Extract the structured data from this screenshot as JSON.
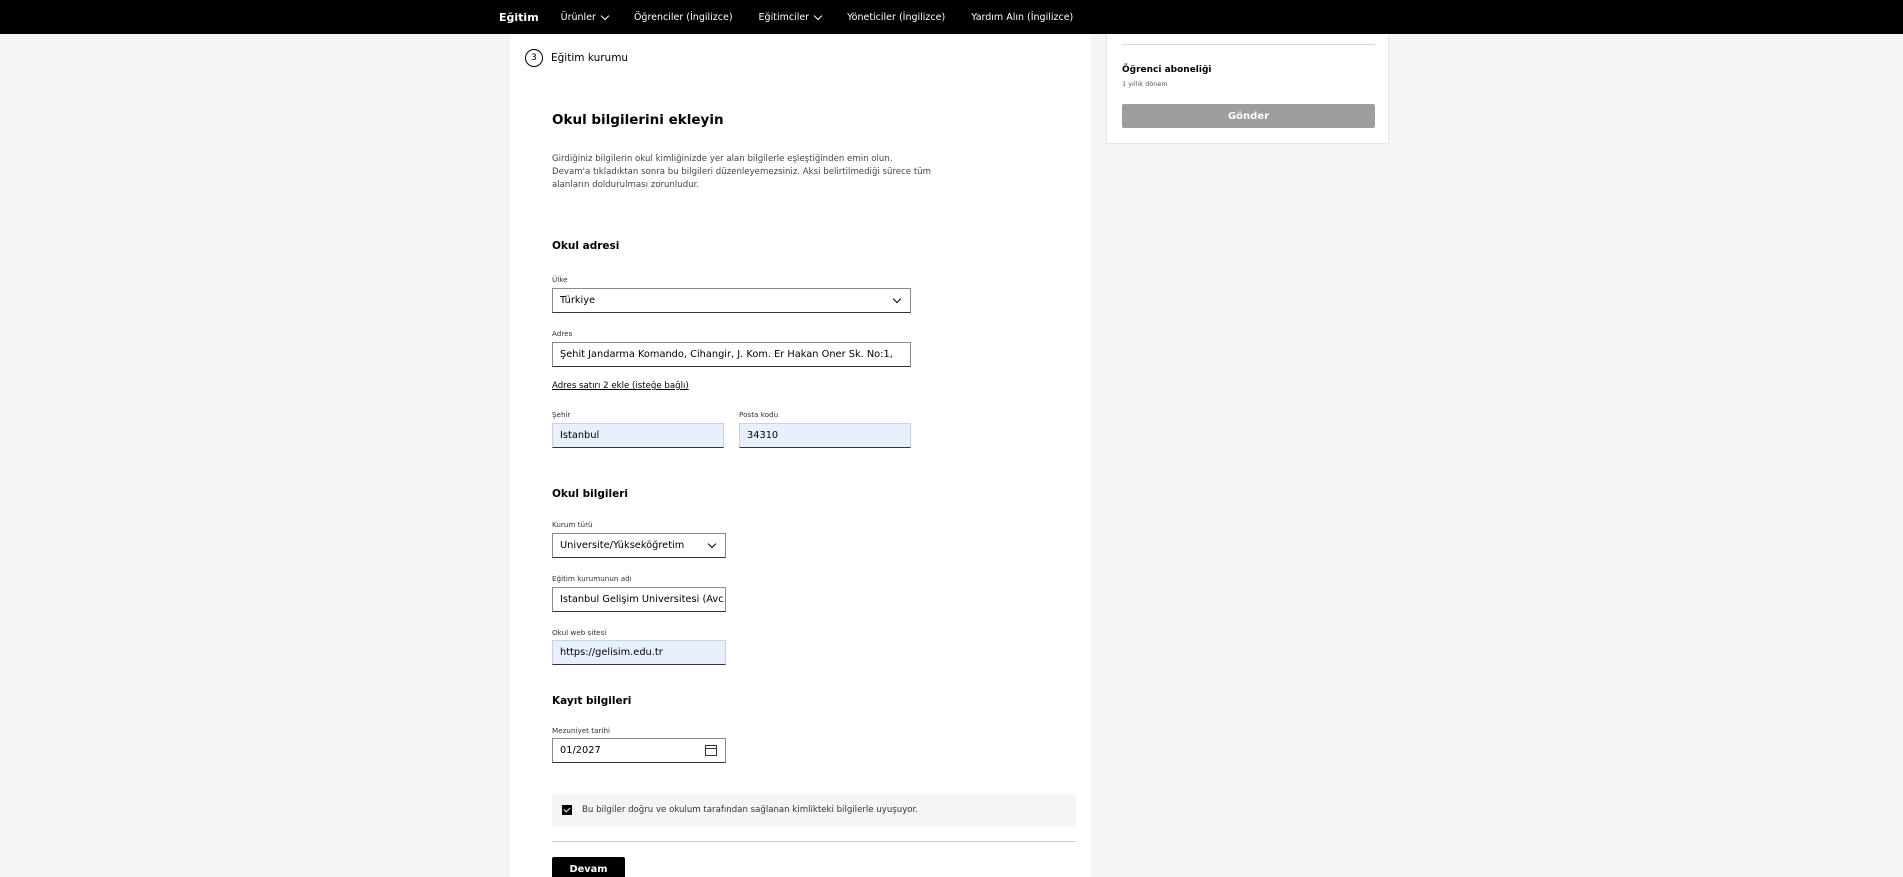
{
  "nav": {
    "brand": "Eğitim",
    "items": [
      {
        "label": "Ürünler",
        "has_dropdown": true
      },
      {
        "label": "Öğrenciler (İngilizce)",
        "has_dropdown": false
      },
      {
        "label": "Eğitimciler",
        "has_dropdown": true
      },
      {
        "label": "Yöneticiler (İngilizce)",
        "has_dropdown": false
      },
      {
        "label": "Yardım Alın (İngilizce)",
        "has_dropdown": false
      }
    ]
  },
  "step": {
    "number": "3",
    "label": "Eğitim kurumu"
  },
  "form": {
    "title": "Okul bilgilerini ekleyin",
    "intro": "Girdiğiniz bilgilerin okul kimliğinizde yer alan bilgilerle eşleştiğinden emin olun. Devam'a tıkladıktan sonra bu bilgileri düzenleyemezsiniz. Aksi belirtilmediği sürece tüm alanların doldurulması zorunludur.",
    "address_section": "Okul adresi",
    "country_label": "Ülke",
    "country_value": "Türkiye",
    "address_label": "Adres",
    "address_value": "Şehit Jandarma Komando, Cihangir, J. Kom. Er Hakan Öner Sk. No:1,",
    "add_line2_link": "Adres satırı 2 ekle (isteğe bağlı)",
    "city_label": "Şehir",
    "city_value": "İstanbul",
    "postal_label": "Posta kodu",
    "postal_value": "34310",
    "school_section": "Okul bilgileri",
    "inst_type_label": "Kurum türü",
    "inst_type_value": "Üniversite/Yükseköğretim",
    "inst_name_label": "Eğitim kurumunun adı",
    "inst_name_value": "İstanbul Gelişim Üniversitesi (Avc",
    "website_label": "Okul web sitesi",
    "website_value": "https://gelisim.edu.tr",
    "enroll_section": "Kayıt bilgileri",
    "grad_label": "Mezuniyet tarihi",
    "grad_value": "01/2027",
    "confirm_text": "Bu bilgiler doğru ve okulum tarafından sağlanan kimlikteki bilgilerle uyuşuyor.",
    "confirm_checked": true,
    "continue_button": "Devam"
  },
  "summary": {
    "title": "Öğrenci aboneliği",
    "subtitle": "1 yıllık dönem",
    "submit_button": "Gönder"
  },
  "colors": {
    "autofill": "#e8f0fe",
    "disabled_button": "#9e9e9e"
  }
}
